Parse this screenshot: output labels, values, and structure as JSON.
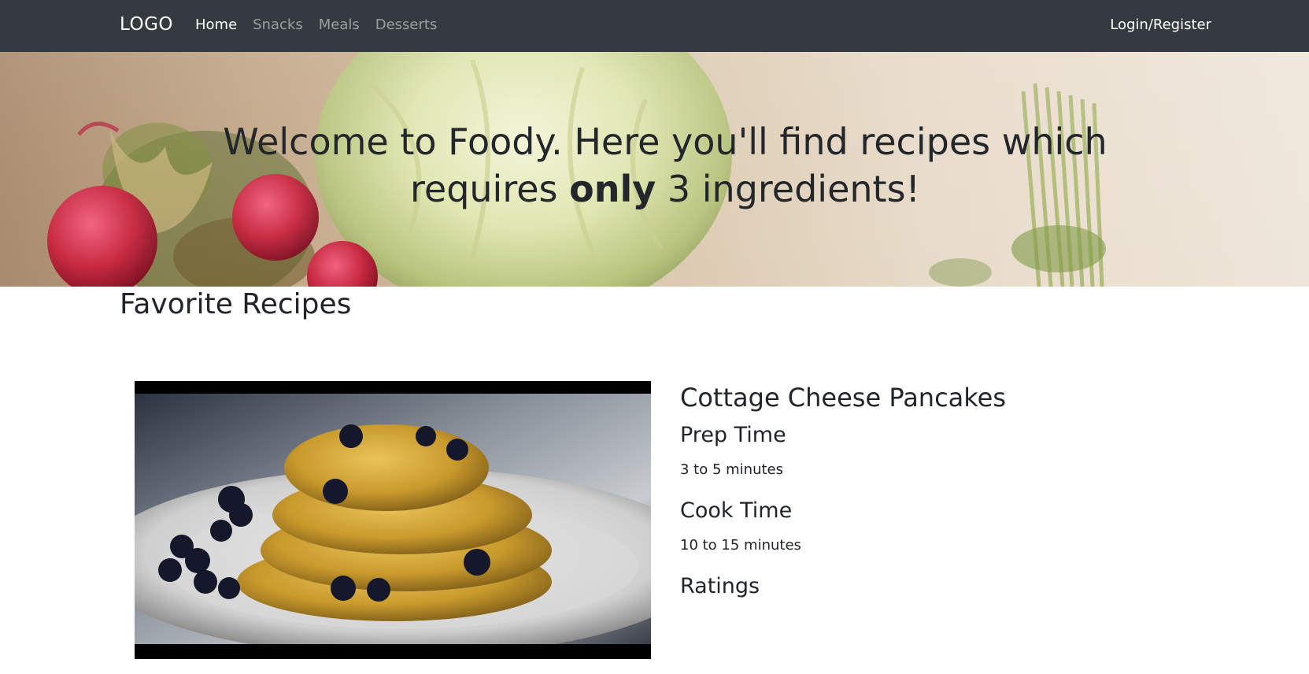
{
  "navbar": {
    "brand": "LOGO",
    "links": [
      "Home",
      "Snacks",
      "Meals",
      "Desserts"
    ],
    "active_link": "Home",
    "login": "Login/Register"
  },
  "hero": {
    "line1": "Welcome to Foody. Here you'll find recipes which",
    "line2_before": "requires ",
    "line2_bold": "only",
    "line2_after": " 3 ingredients!"
  },
  "favorites": {
    "title": "Favorite Recipes",
    "recipe": {
      "name": "Cottage Cheese Pancakes",
      "prep_label": "Prep Time",
      "prep_value": "3 to 5 minutes",
      "cook_label": "Cook Time",
      "cook_value": "10 to 15 minutes",
      "ratings_label": "Ratings"
    }
  },
  "colors": {
    "navbar_bg": "#343a40",
    "text": "#212529"
  },
  "icons": {
    "hero_image": "vegetables-photo",
    "recipe_image": "pancakes-photo"
  }
}
